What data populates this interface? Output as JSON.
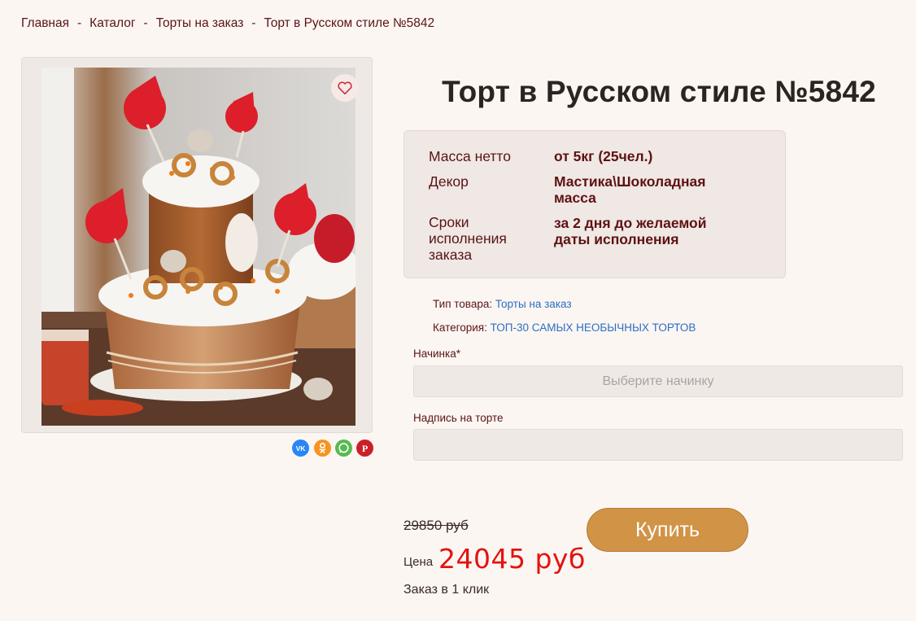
{
  "breadcrumb": {
    "items": [
      "Главная",
      "Каталог",
      "Торты на заказ"
    ],
    "separator": "-",
    "current": "Торт в Русском стиле №5842"
  },
  "product": {
    "title": "Торт в Русском стиле №5842",
    "specs": [
      {
        "label": "Масса нетто",
        "value": "от 5кг (25чел.)"
      },
      {
        "label": "Декор",
        "value": "Мастика\\Шоколадная масса"
      },
      {
        "label": "Сроки исполнения заказа",
        "value": "за 2 дня до желаемой даты исполнения"
      }
    ],
    "type_label": "Тип товара:",
    "type_value": "Торты на заказ",
    "category_label": "Категория:",
    "category_value": "ТОП-30 САМЫХ НЕОБЫЧНЫХ ТОРТОВ"
  },
  "form": {
    "filling_label": "Начинка*",
    "filling_placeholder": "Выберите начинку",
    "inscription_label": "Надпись на торте",
    "inscription_value": ""
  },
  "pricing": {
    "old_price": "29850 руб",
    "price_label": "Цена",
    "price": "24045 руб",
    "buy_label": "Купить",
    "one_click_label": "Заказ в 1 клик"
  },
  "share": {
    "icons": [
      {
        "name": "vk-icon",
        "text": "VK",
        "color": "#2787f5"
      },
      {
        "name": "odnoklassniki-icon",
        "text": "ok",
        "color": "#f7931e"
      },
      {
        "name": "whatsapp-icon",
        "text": "",
        "color": "#57ba4f"
      },
      {
        "name": "pinterest-icon",
        "text": "P",
        "color": "#cb2027"
      }
    ]
  },
  "colors": {
    "accent_button": "#d19346",
    "price_red": "#e3130f",
    "link_blue": "#2a6fc4",
    "text_maroon": "#5a1414",
    "background": "#fcf6f3"
  }
}
